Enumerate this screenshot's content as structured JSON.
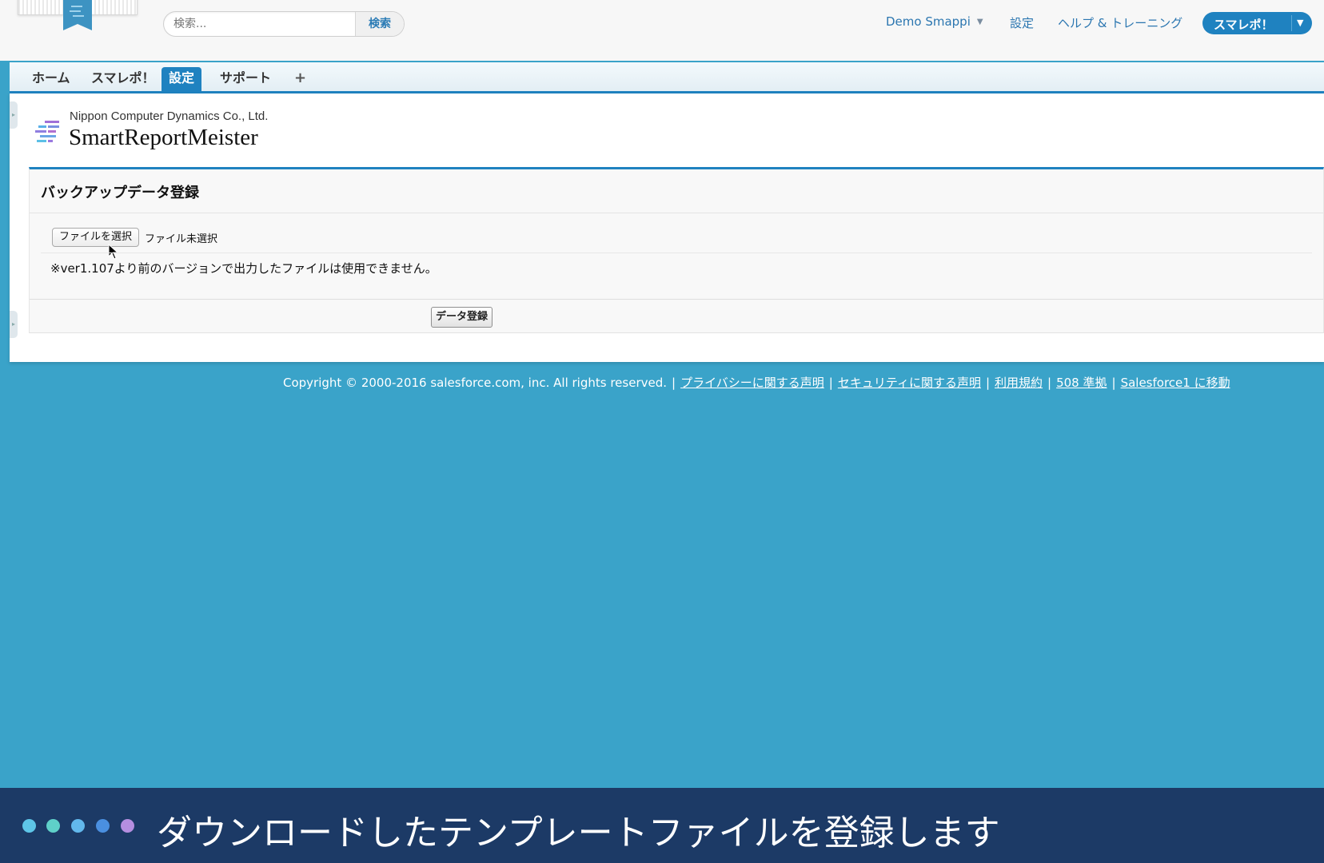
{
  "search": {
    "placeholder": "検索...",
    "button_label": "検索"
  },
  "user_menu": {
    "name": "Demo Smappi",
    "setup": "設定",
    "help": "ヘルプ & トレーニング"
  },
  "app_switcher": {
    "label": "スマレポ！"
  },
  "tabs": [
    {
      "label": "ホーム"
    },
    {
      "label": "スマレポ！"
    },
    {
      "label": "設定",
      "active": true
    },
    {
      "label": "サポート"
    },
    {
      "label": "+"
    }
  ],
  "brand": {
    "company": "Nippon Computer Dynamics Co., Ltd.",
    "product": "SmartReportMeister"
  },
  "panel": {
    "title": "バックアップデータ登録",
    "file_button": "ファイルを選択",
    "file_status": "ファイル未選択",
    "note": "※ver1.107より前のバージョンで出力したファイルは使用できません。",
    "submit": "データ登録"
  },
  "footer": {
    "copyright": "Copyright © 2000-2016 salesforce.com, inc. All rights reserved.",
    "links": [
      "プライバシーに関する声明",
      "セキュリティに関する声明",
      "利用規約",
      "508 準拠",
      "Salesforce1 に移動"
    ]
  },
  "caption": {
    "text": "ダウンロードしたテンプレートファイルを登録します",
    "dot_colors": [
      "#5ec6e8",
      "#5fd0c9",
      "#62b8ec",
      "#4a8fe0",
      "#b58ee0"
    ]
  },
  "colors": {
    "accent": "#1f82c0",
    "background": "#3aa3c9",
    "caption_bar": "#1c3a66"
  }
}
